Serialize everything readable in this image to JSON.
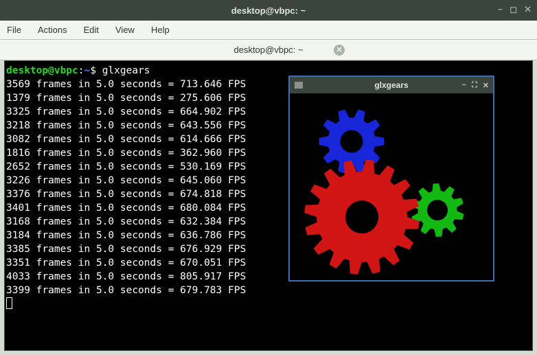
{
  "window": {
    "title": "desktop@vbpc: ~",
    "controls": {
      "min": "−",
      "max": "◻",
      "close": "✕"
    }
  },
  "menubar": {
    "file": "File",
    "actions": "Actions",
    "edit": "Edit",
    "view": "View",
    "help": "Help"
  },
  "tab": {
    "label": "desktop@vbpc: ~",
    "close": "✕"
  },
  "terminal": {
    "prompt": {
      "user": "desktop@vbpc",
      "colon": ":",
      "path": "~",
      "dollar": "$"
    },
    "command": "glxgears",
    "output": [
      {
        "frames": 3569,
        "sec": "5.0",
        "fps": "713.646"
      },
      {
        "frames": 1379,
        "sec": "5.0",
        "fps": "275.606"
      },
      {
        "frames": 3325,
        "sec": "5.0",
        "fps": "664.902"
      },
      {
        "frames": 3218,
        "sec": "5.0",
        "fps": "643.556"
      },
      {
        "frames": 3082,
        "sec": "5.0",
        "fps": "614.666"
      },
      {
        "frames": 1816,
        "sec": "5.0",
        "fps": "362.960"
      },
      {
        "frames": 2652,
        "sec": "5.0",
        "fps": "530.169"
      },
      {
        "frames": 3226,
        "sec": "5.0",
        "fps": "645.060"
      },
      {
        "frames": 3376,
        "sec": "5.0",
        "fps": "674.818"
      },
      {
        "frames": 3401,
        "sec": "5.0",
        "fps": "680.084"
      },
      {
        "frames": 3168,
        "sec": "5.0",
        "fps": "632.384"
      },
      {
        "frames": 3184,
        "sec": "5.0",
        "fps": "636.786"
      },
      {
        "frames": 3385,
        "sec": "5.0",
        "fps": "676.929"
      },
      {
        "frames": 3351,
        "sec": "5.0",
        "fps": "670.051"
      },
      {
        "frames": 4033,
        "sec": "5.0",
        "fps": "805.917"
      },
      {
        "frames": 3399,
        "sec": "5.0",
        "fps": "679.783"
      }
    ]
  },
  "glxgears_window": {
    "title": "glxgears",
    "controls": {
      "min": "−",
      "max": "⛶",
      "close": "✕"
    },
    "gears": {
      "red": "#d11515",
      "green": "#13b913",
      "blue": "#1626d8"
    }
  }
}
